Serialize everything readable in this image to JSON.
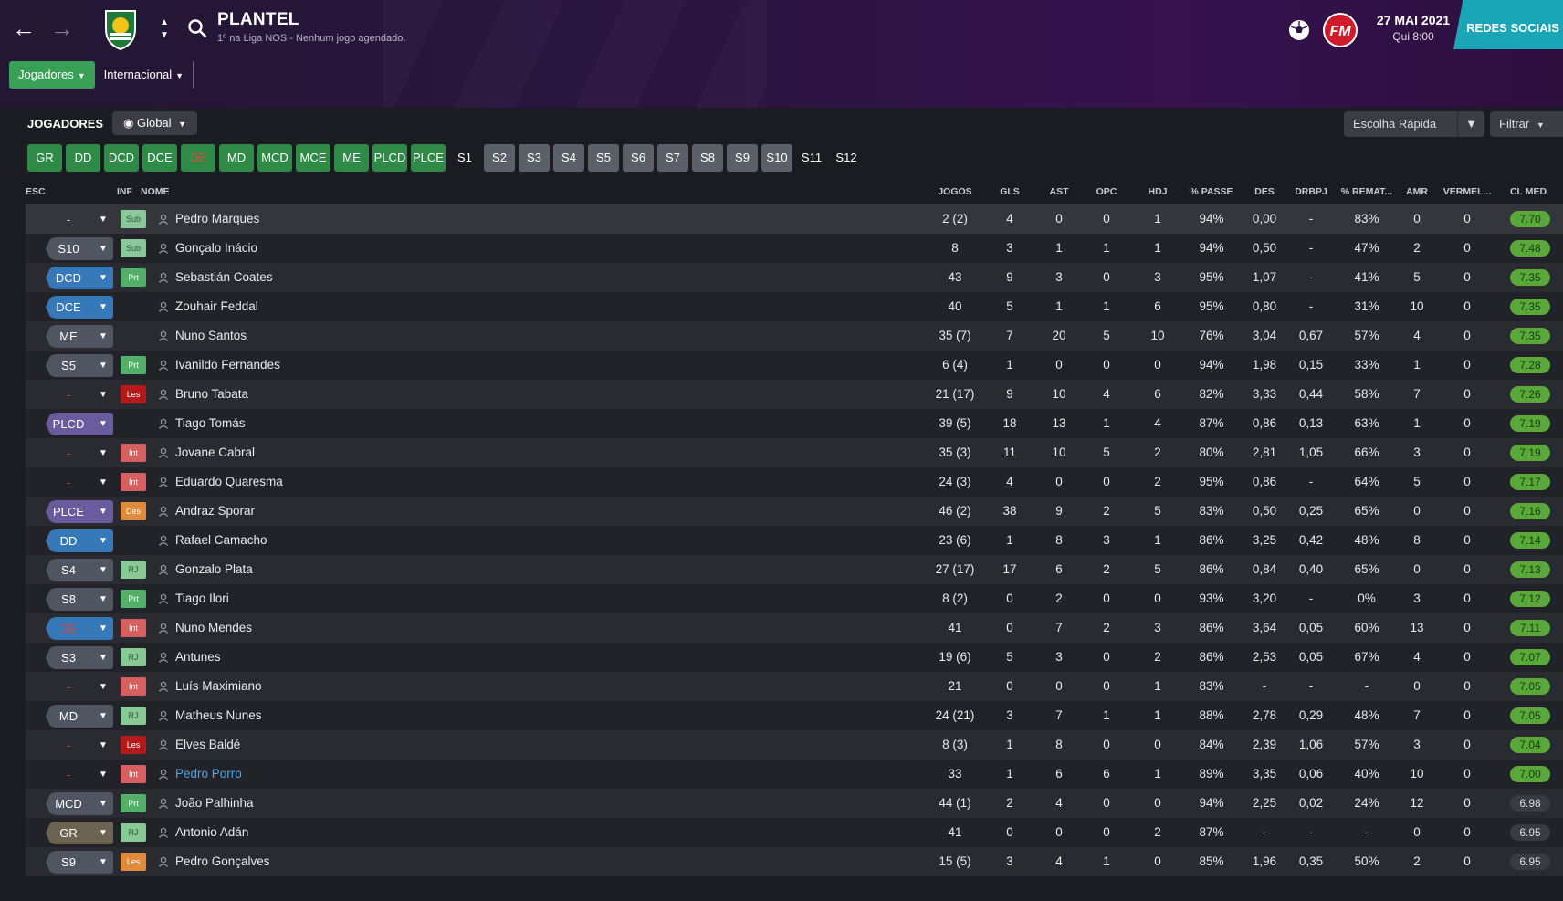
{
  "header": {
    "title": "PLANTEL",
    "subtitle": "1º na Liga NOS - Nenhum jogo agendado.",
    "date": "27 MAI 2021",
    "time": "Qui 8:00",
    "social_label": "REDES SOCIAIS",
    "fm_logo": "FM",
    "tabs": [
      {
        "label": "Jogadores"
      },
      {
        "label": "Internacional"
      }
    ]
  },
  "toolbar": {
    "section_label": "JOGADORES",
    "view_label": "Global",
    "quick_pick_label": "Escolha Rápida",
    "filter_label": "Filtrar"
  },
  "position_filters": [
    {
      "label": "GR",
      "style": "green"
    },
    {
      "label": "DD",
      "style": "green"
    },
    {
      "label": "DCD",
      "style": "green"
    },
    {
      "label": "DCE",
      "style": "green"
    },
    {
      "label": "DE",
      "style": "green-hl"
    },
    {
      "label": "MD",
      "style": "green"
    },
    {
      "label": "MCD",
      "style": "green"
    },
    {
      "label": "MCE",
      "style": "green"
    },
    {
      "label": "ME",
      "style": "green"
    },
    {
      "label": "PLCD",
      "style": "green"
    },
    {
      "label": "PLCE",
      "style": "green"
    },
    {
      "label": "S1",
      "style": "plain"
    },
    {
      "label": "S2",
      "style": "grey"
    },
    {
      "label": "S3",
      "style": "grey"
    },
    {
      "label": "S4",
      "style": "grey"
    },
    {
      "label": "S5",
      "style": "grey"
    },
    {
      "label": "S6",
      "style": "grey"
    },
    {
      "label": "S7",
      "style": "grey"
    },
    {
      "label": "S8",
      "style": "grey"
    },
    {
      "label": "S9",
      "style": "grey"
    },
    {
      "label": "S10",
      "style": "grey"
    },
    {
      "label": "S11",
      "style": "plain"
    },
    {
      "label": "S12",
      "style": "plain"
    }
  ],
  "columns": {
    "esc": "ESC",
    "inf": "INF",
    "nome": "NOME",
    "jogos": "JOGOS",
    "gls": "GLS",
    "ast": "AST",
    "opc": "OPC",
    "hdj": "HDJ",
    "passe": "% PASSE",
    "des": "DES",
    "drbpj": "DRBPJ",
    "remat": "% REMAT...",
    "amr": "AMR",
    "vermel": "VERMEL...",
    "clmed": "CL MED"
  },
  "players": [
    {
      "sel": "-",
      "sel_style": "none",
      "inf": "Sub",
      "inf_style": "sub",
      "name": "Pedro Marques",
      "jogos": "2 (2)",
      "gls": "4",
      "ast": "0",
      "opc": "0",
      "hdj": "1",
      "passe": "94%",
      "des": "0,00",
      "drbpj": "-",
      "remat": "83%",
      "amr": "0",
      "vermel": "0",
      "clmed": "7.70",
      "rating_style": "hi"
    },
    {
      "sel": "S10",
      "sel_style": "slate",
      "inf": "Sub",
      "inf_style": "sub",
      "name": "Gonçalo Inácio",
      "jogos": "8",
      "gls": "3",
      "ast": "1",
      "opc": "1",
      "hdj": "1",
      "passe": "94%",
      "des": "0,50",
      "drbpj": "-",
      "remat": "47%",
      "amr": "2",
      "vermel": "0",
      "clmed": "7.48",
      "rating_style": "hi"
    },
    {
      "sel": "DCD",
      "sel_style": "blue",
      "inf": "Prt",
      "inf_style": "prt",
      "name": "Sebastián Coates",
      "jogos": "43",
      "gls": "9",
      "ast": "3",
      "opc": "0",
      "hdj": "3",
      "passe": "95%",
      "des": "1,07",
      "drbpj": "-",
      "remat": "41%",
      "amr": "5",
      "vermel": "0",
      "clmed": "7.35",
      "rating_style": "hi"
    },
    {
      "sel": "DCE",
      "sel_style": "blue",
      "inf": "",
      "inf_style": "",
      "name": "Zouhair Feddal",
      "jogos": "40",
      "gls": "5",
      "ast": "1",
      "opc": "1",
      "hdj": "6",
      "passe": "95%",
      "des": "0,80",
      "drbpj": "-",
      "remat": "31%",
      "amr": "10",
      "vermel": "0",
      "clmed": "7.35",
      "rating_style": "hi"
    },
    {
      "sel": "ME",
      "sel_style": "slate",
      "inf": "",
      "inf_style": "",
      "name": "Nuno Santos",
      "jogos": "35 (7)",
      "gls": "7",
      "ast": "20",
      "opc": "5",
      "hdj": "10",
      "passe": "76%",
      "des": "3,04",
      "drbpj": "0,67",
      "remat": "57%",
      "amr": "4",
      "vermel": "0",
      "clmed": "7.35",
      "rating_style": "hi"
    },
    {
      "sel": "S5",
      "sel_style": "slate",
      "inf": "Prt",
      "inf_style": "prt",
      "name": "Ivanildo Fernandes",
      "jogos": "6 (4)",
      "gls": "1",
      "ast": "0",
      "opc": "0",
      "hdj": "0",
      "passe": "94%",
      "des": "1,98",
      "drbpj": "0,15",
      "remat": "33%",
      "amr": "1",
      "vermel": "0",
      "clmed": "7.28",
      "rating_style": "hi"
    },
    {
      "sel": "-",
      "sel_style": "none-red",
      "inf": "Les",
      "inf_style": "les",
      "name": "Bruno Tabata",
      "jogos": "21 (17)",
      "gls": "9",
      "ast": "10",
      "opc": "4",
      "hdj": "6",
      "passe": "82%",
      "des": "3,33",
      "drbpj": "0,44",
      "remat": "58%",
      "amr": "7",
      "vermel": "0",
      "clmed": "7.26",
      "rating_style": "hi"
    },
    {
      "sel": "PLCD",
      "sel_style": "purple",
      "inf": "",
      "inf_style": "",
      "name": "Tiago Tomás",
      "jogos": "39 (5)",
      "gls": "18",
      "ast": "13",
      "opc": "1",
      "hdj": "4",
      "passe": "87%",
      "des": "0,86",
      "drbpj": "0,13",
      "remat": "63%",
      "amr": "1",
      "vermel": "0",
      "clmed": "7.19",
      "rating_style": "hi"
    },
    {
      "sel": "-",
      "sel_style": "none-red",
      "inf": "Int",
      "inf_style": "int",
      "name": "Jovane Cabral",
      "jogos": "35 (3)",
      "gls": "11",
      "ast": "10",
      "opc": "5",
      "hdj": "2",
      "passe": "80%",
      "des": "2,81",
      "drbpj": "1,05",
      "remat": "66%",
      "amr": "3",
      "vermel": "0",
      "clmed": "7.19",
      "rating_style": "hi"
    },
    {
      "sel": "-",
      "sel_style": "none-red",
      "inf": "Int",
      "inf_style": "int",
      "name": "Eduardo Quaresma",
      "jogos": "24 (3)",
      "gls": "4",
      "ast": "0",
      "opc": "0",
      "hdj": "2",
      "passe": "95%",
      "des": "0,86",
      "drbpj": "-",
      "remat": "64%",
      "amr": "5",
      "vermel": "0",
      "clmed": "7.17",
      "rating_style": "hi"
    },
    {
      "sel": "PLCE",
      "sel_style": "purple",
      "inf": "Des",
      "inf_style": "des",
      "name": "Andraz Sporar",
      "jogos": "46 (2)",
      "gls": "38",
      "ast": "9",
      "opc": "2",
      "hdj": "5",
      "passe": "83%",
      "des": "0,50",
      "drbpj": "0,25",
      "remat": "65%",
      "amr": "0",
      "vermel": "0",
      "clmed": "7.16",
      "rating_style": "hi"
    },
    {
      "sel": "DD",
      "sel_style": "blue",
      "inf": "",
      "inf_style": "",
      "name": "Rafael Camacho",
      "jogos": "23 (6)",
      "gls": "1",
      "ast": "8",
      "opc": "3",
      "hdj": "1",
      "passe": "86%",
      "des": "3,25",
      "drbpj": "0,42",
      "remat": "48%",
      "amr": "8",
      "vermel": "0",
      "clmed": "7.14",
      "rating_style": "hi"
    },
    {
      "sel": "S4",
      "sel_style": "slate",
      "inf": "RJ",
      "inf_style": "rj",
      "name": "Gonzalo Plata",
      "jogos": "27 (17)",
      "gls": "17",
      "ast": "6",
      "opc": "2",
      "hdj": "5",
      "passe": "86%",
      "des": "0,84",
      "drbpj": "0,40",
      "remat": "65%",
      "amr": "0",
      "vermel": "0",
      "clmed": "7.13",
      "rating_style": "hi"
    },
    {
      "sel": "S8",
      "sel_style": "slate",
      "inf": "Prt",
      "inf_style": "prt",
      "name": "Tiago Ilori",
      "jogos": "8 (2)",
      "gls": "0",
      "ast": "2",
      "opc": "0",
      "hdj": "0",
      "passe": "93%",
      "des": "3,20",
      "drbpj": "-",
      "remat": "0%",
      "amr": "3",
      "vermel": "0",
      "clmed": "7.12",
      "rating_style": "hi"
    },
    {
      "sel": "DE",
      "sel_style": "blue-red",
      "inf": "Int",
      "inf_style": "int",
      "name": "Nuno Mendes",
      "jogos": "41",
      "gls": "0",
      "ast": "7",
      "opc": "2",
      "hdj": "3",
      "passe": "86%",
      "des": "3,64",
      "drbpj": "0,05",
      "remat": "60%",
      "amr": "13",
      "vermel": "0",
      "clmed": "7.11",
      "rating_style": "hi"
    },
    {
      "sel": "S3",
      "sel_style": "slate",
      "inf": "RJ",
      "inf_style": "rj",
      "name": "Antunes",
      "jogos": "19 (6)",
      "gls": "5",
      "ast": "3",
      "opc": "0",
      "hdj": "2",
      "passe": "86%",
      "des": "2,53",
      "drbpj": "0,05",
      "remat": "67%",
      "amr": "4",
      "vermel": "0",
      "clmed": "7.07",
      "rating_style": "hi"
    },
    {
      "sel": "-",
      "sel_style": "none-red",
      "inf": "Int",
      "inf_style": "int",
      "name": "Luís Maximiano",
      "jogos": "21",
      "gls": "0",
      "ast": "0",
      "opc": "0",
      "hdj": "1",
      "passe": "83%",
      "des": "-",
      "drbpj": "-",
      "remat": "-",
      "amr": "0",
      "vermel": "0",
      "clmed": "7.05",
      "rating_style": "hi"
    },
    {
      "sel": "MD",
      "sel_style": "slate",
      "inf": "RJ",
      "inf_style": "rj",
      "name": "Matheus Nunes",
      "jogos": "24 (21)",
      "gls": "3",
      "ast": "7",
      "opc": "1",
      "hdj": "1",
      "passe": "88%",
      "des": "2,78",
      "drbpj": "0,29",
      "remat": "48%",
      "amr": "7",
      "vermel": "0",
      "clmed": "7.05",
      "rating_style": "hi"
    },
    {
      "sel": "-",
      "sel_style": "none-red",
      "inf": "Les",
      "inf_style": "les",
      "name": "Elves Baldé",
      "jogos": "8 (3)",
      "gls": "1",
      "ast": "8",
      "opc": "0",
      "hdj": "0",
      "passe": "84%",
      "des": "2,39",
      "drbpj": "1,06",
      "remat": "57%",
      "amr": "3",
      "vermel": "0",
      "clmed": "7.04",
      "rating_style": "hi"
    },
    {
      "sel": "-",
      "sel_style": "none-red",
      "inf": "Int",
      "inf_style": "int",
      "name": "Pedro Porro",
      "link": true,
      "jogos": "33",
      "gls": "1",
      "ast": "6",
      "opc": "6",
      "hdj": "1",
      "passe": "89%",
      "des": "3,35",
      "drbpj": "0,06",
      "remat": "40%",
      "amr": "10",
      "vermel": "0",
      "clmed": "7.00",
      "rating_style": "hi"
    },
    {
      "sel": "MCD",
      "sel_style": "slate",
      "inf": "Prt",
      "inf_style": "prt",
      "name": "João Palhinha",
      "jogos": "44 (1)",
      "gls": "2",
      "ast": "4",
      "opc": "0",
      "hdj": "0",
      "passe": "94%",
      "des": "2,25",
      "drbpj": "0,02",
      "remat": "24%",
      "amr": "12",
      "vermel": "0",
      "clmed": "6.98",
      "rating_style": "mid"
    },
    {
      "sel": "GR",
      "sel_style": "olive",
      "inf": "RJ",
      "inf_style": "rj",
      "name": "Antonio Adán",
      "jogos": "41",
      "gls": "0",
      "ast": "0",
      "opc": "0",
      "hdj": "2",
      "passe": "87%",
      "des": "-",
      "drbpj": "-",
      "remat": "-",
      "amr": "0",
      "vermel": "0",
      "clmed": "6.95",
      "rating_style": "mid"
    },
    {
      "sel": "S9",
      "sel_style": "slate",
      "inf": "Les",
      "inf_style": "des",
      "name": "Pedro Gonçalves",
      "jogos": "15 (5)",
      "gls": "3",
      "ast": "4",
      "opc": "1",
      "hdj": "0",
      "passe": "85%",
      "des": "1,96",
      "drbpj": "0,35",
      "remat": "50%",
      "amr": "2",
      "vermel": "0",
      "clmed": "6.95",
      "rating_style": "mid"
    }
  ]
}
